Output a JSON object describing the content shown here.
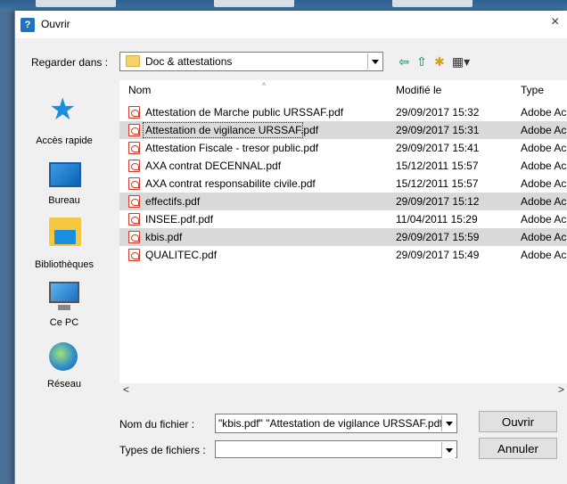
{
  "dialog": {
    "title": "Ouvrir",
    "close_glyph": "×"
  },
  "look_in": {
    "label": "Regarder dans :",
    "value": "Doc & attestations",
    "icon": "folder-icon"
  },
  "toolbar": {
    "back_icon": "back-arrow-icon",
    "back_glyph": "⇦",
    "up_icon": "up-folder-icon",
    "up_glyph": "⇧",
    "new_icon": "new-folder-icon",
    "new_glyph": "✱",
    "view_icon": "view-menu-icon",
    "view_glyph": "▦▾"
  },
  "places": [
    {
      "label": "Accès rapide",
      "icon": "star-icon"
    },
    {
      "label": "Bureau",
      "icon": "desktop-icon"
    },
    {
      "label": "Bibliothèques",
      "icon": "libraries-icon"
    },
    {
      "label": "Ce PC",
      "icon": "computer-icon"
    },
    {
      "label": "Réseau",
      "icon": "network-icon"
    }
  ],
  "columns": {
    "name": "Nom",
    "modified": "Modifié le",
    "type": "Type",
    "sort_glyph": "^"
  },
  "files": [
    {
      "name": "Attestation de Marche public URSSAF.pdf",
      "modified": "29/09/2017 15:32",
      "type": "Adobe Ac",
      "selected": false
    },
    {
      "name": "Attestation de vigilance URSSAF.pdf",
      "modified": "29/09/2017 15:31",
      "type": "Adobe Ac",
      "selected": true
    },
    {
      "name": "Attestation Fiscale - tresor public.pdf",
      "modified": "29/09/2017 15:41",
      "type": "Adobe Ac",
      "selected": false
    },
    {
      "name": "AXA contrat DECENNAL.pdf",
      "modified": "15/12/2011 15:57",
      "type": "Adobe Ac",
      "selected": false
    },
    {
      "name": "AXA contrat responsabilite civile.pdf",
      "modified": "15/12/2011 15:57",
      "type": "Adobe Ac",
      "selected": false
    },
    {
      "name": "effectifs.pdf",
      "modified": "29/09/2017 15:12",
      "type": "Adobe Ac",
      "selected": true
    },
    {
      "name": "INSEE.pdf.pdf",
      "modified": "11/04/2011 15:29",
      "type": "Adobe Ac",
      "selected": false
    },
    {
      "name": "kbis.pdf",
      "modified": "29/09/2017 15:59",
      "type": "Adobe Ac",
      "selected": true
    },
    {
      "name": "QUALITEC.pdf",
      "modified": "29/09/2017 15:49",
      "type": "Adobe Ac",
      "selected": false
    }
  ],
  "scrollbar": {
    "left_glyph": "<",
    "right_glyph": ">"
  },
  "filename": {
    "label": "Nom du fichier :",
    "value": "\"kbis.pdf\" \"Attestation de vigilance URSSAF.pdf\""
  },
  "filetype": {
    "label": "Types de fichiers :",
    "value": ""
  },
  "buttons": {
    "open": "Ouvrir",
    "cancel": "Annuler"
  },
  "colors": {
    "selection": "#d9d9d9",
    "pdf_red": "#d23b2c",
    "accent_blue": "#1a8fe0"
  }
}
